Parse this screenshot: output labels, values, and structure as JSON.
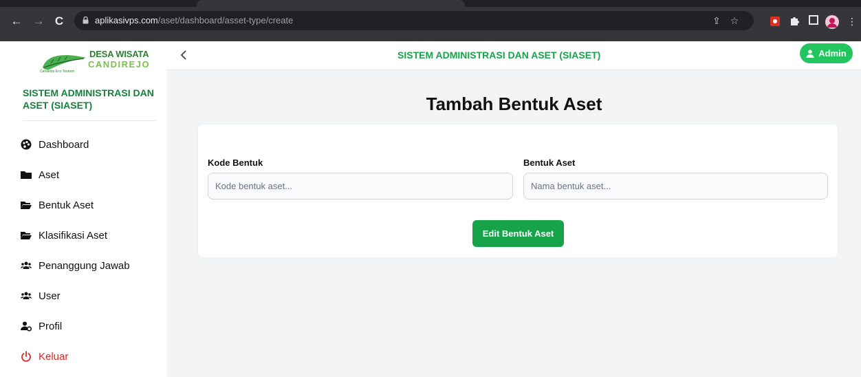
{
  "browser": {
    "url_host": "aplikasivps.com",
    "url_path": "/aset/dashboard/asset-type/create"
  },
  "brand": {
    "line1": "DESA WISATA",
    "line2": "CANDIREJO",
    "tagline": "Candirejo Eco Tourism"
  },
  "sidebar": {
    "title": "SISTEM ADMINISTRASI DAN ASET (SIASET)",
    "items": [
      {
        "label": "Dashboard",
        "icon": "palette-icon"
      },
      {
        "label": "Aset",
        "icon": "folder-icon"
      },
      {
        "label": "Bentuk Aset",
        "icon": "folder-open-icon"
      },
      {
        "label": "Klasifikasi Aset",
        "icon": "folder-open-icon"
      },
      {
        "label": "Penanggung Jawab",
        "icon": "users-icon"
      },
      {
        "label": "User",
        "icon": "users-icon"
      },
      {
        "label": "Profil",
        "icon": "user-gear-icon"
      },
      {
        "label": "Keluar",
        "icon": "power-icon"
      }
    ]
  },
  "header": {
    "title": "SISTEM ADMINISTRASI DAN ASET (SIASET)",
    "user_label": "Admin"
  },
  "main": {
    "page_title": "Tambah Bentuk Aset",
    "form": {
      "code_label": "Kode Bentuk",
      "code_value": "",
      "code_placeholder": "Kode bentuk aset...",
      "name_label": "Bentuk Aset",
      "name_value": "",
      "name_placeholder": "Nama bentuk aset...",
      "submit_label": "Edit Bentuk Aset"
    }
  },
  "colors": {
    "accent": "#22c55e",
    "title_green": "#16a34a",
    "logout_red": "#dc2626"
  }
}
